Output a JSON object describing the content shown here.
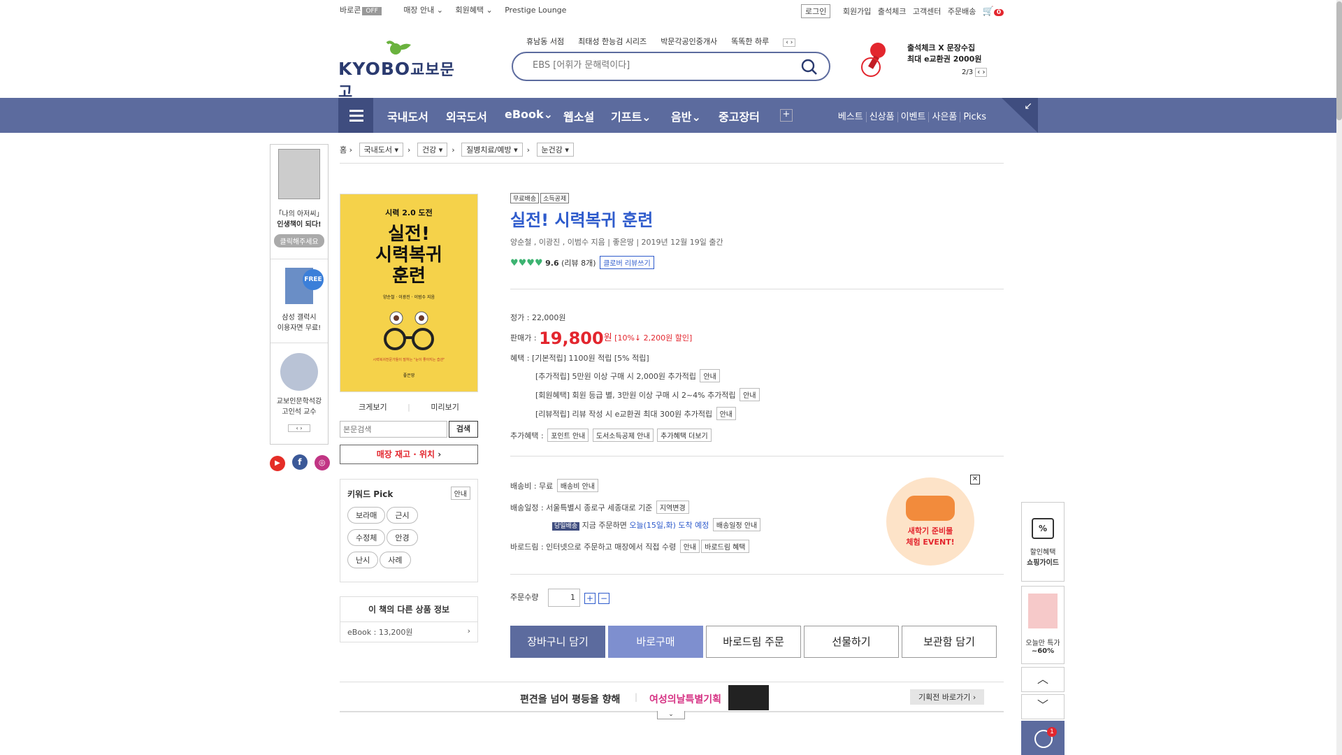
{
  "top": {
    "baroquan": "바로콘",
    "off": "OFF",
    "store": "매장 안내",
    "member": "회원혜택",
    "prestige": "Prestige Lounge",
    "login": "로그인",
    "join": "회원가입",
    "attend": "출석체크",
    "cs": "고객센터",
    "order": "주문배송",
    "cart_count": "0"
  },
  "header": {
    "logo_en": "KYOBO",
    "logo_ko": "교보문고",
    "hot": [
      "휴남동 서점",
      "최태성 한능검 시리즈",
      "박문각공인중개사",
      "똑똑한 하루"
    ],
    "search_placeholder": "EBS [어휘가 문해력이다]",
    "promo_line1": "출석체크 X 문장수집",
    "promo_line2": "최대 e교환권 2000원",
    "promo_page": "2/3"
  },
  "nav": {
    "items": [
      "국내도서",
      "외국도서",
      "eBook",
      "웹소설",
      "기프트",
      "음반",
      "중고장터"
    ],
    "right": [
      "베스트",
      "신상품",
      "이벤트",
      "사은품",
      "Picks"
    ]
  },
  "bread": {
    "home": "홈",
    "c1": "국내도서",
    "c2": "건강",
    "c3": "질병치료/예방",
    "c4": "눈건강"
  },
  "leftban": {
    "b1a": "「나의 아저씨」",
    "b1b": "인생책이 되다!",
    "b1btn": "클릭해주세요",
    "free": "FREE",
    "b2a": "삼성 갤럭시",
    "b2b": "이용자면 무료!",
    "b3a": "교보인문학석강",
    "b3b": "고인석 교수"
  },
  "cover": {
    "top": "시력 2.0 도전",
    "t1": "실전!",
    "t2": "시력복귀",
    "t3": "훈련",
    "authors": "양순철 · 이광진 · 이범수 지음",
    "tag": "시력복귀전문가들이 말하는 \"눈이 좋아지는 습관\"",
    "pub": "좋은땅"
  },
  "left": {
    "zoom": "크게보기",
    "preview": "미리보기",
    "search_ph": "본문검색",
    "search_btn": "검색",
    "stock": "매장 재고 · 위치",
    "kw_title": "키워드 Pick",
    "kw_info": "안내",
    "keywords": [
      "보라매",
      "근시",
      "수정체",
      "안경",
      "난시",
      "사례"
    ],
    "other_title": "이 책의 다른 상품 정보",
    "ebook": "eBook : 13,200원"
  },
  "product": {
    "badge1": "무료배송",
    "badge2": "소득공제",
    "title": "실전! 시력복귀 훈련",
    "authors": "양순철 , 이광진 , 이범수 지음 | 좋은땅 | 2019년 12월 19일 출간",
    "rating": "9.6",
    "reviews": "(리뷰 8개)",
    "review_btn": "클로버 리뷰쓰기",
    "list_price": "정가 : 22,000원",
    "sale_label": "판매가 :",
    "sale_price": "19,800",
    "won": "원",
    "discount": "[10%↓ 2,200원 할인]",
    "benefit_label": "혜택 :",
    "benefit1": "[기본적립] 1100원 적립 [5% 적립]",
    "benefit2": "[추가적립] 5만원 이상 구매 시 2,000원 추가적립",
    "benefit3": "[회원혜택] 회원 등급 별, 3만원 이상 구매 시 2~4% 추가적립",
    "benefit4": "[리뷰적립] 리뷰 작성 시 e교환권 최대 300원 추가적립",
    "info": "안내",
    "extra_label": "추가혜택 :",
    "extra1": "포인트 안내",
    "extra2": "도서소득공제 안내",
    "extra3": "추가혜택 더보기",
    "ship_fee": "배송비 : 무료",
    "ship_fee_btn": "배송비 안내",
    "ship_sched": "배송일정 : 서울특별시 종로구 세종대로 기준",
    "region_btn": "지역변경",
    "sameday": "당일배송",
    "sameday_text": "지금 주문하면",
    "sameday_date": "오늘(15일,화) 도착 예정",
    "sched_btn": "배송일정 안내",
    "barodrim": "바로드림 : 인터넷으로 주문하고 매장에서 직접 수령",
    "baro_info": "안내",
    "baro_btn": "바로드림 혜택",
    "qty_label": "주문수량",
    "qty": "1",
    "cart": "장바구니 담기",
    "buy": "바로구매",
    "barodrim_order": "바로드림 주문",
    "gift": "선물하기",
    "wish": "보관함 담기",
    "event1": "새학기 준비물",
    "event2": "체험 EVENT!"
  },
  "side": {
    "guide1": "할인혜택",
    "guide2": "쇼핑가이드",
    "deal1": "오늘만 특가",
    "deal2": "~60%",
    "recent": "1"
  },
  "bottom": {
    "t1": "편견을 넘어 평등을 향해",
    "t2": "여성의날특별기획",
    "btn": "기획전 바로가기"
  },
  "colors": {
    "navy": "#5c6b9e",
    "accent_red": "#e3262e",
    "title_blue": "#2e5bcc"
  }
}
